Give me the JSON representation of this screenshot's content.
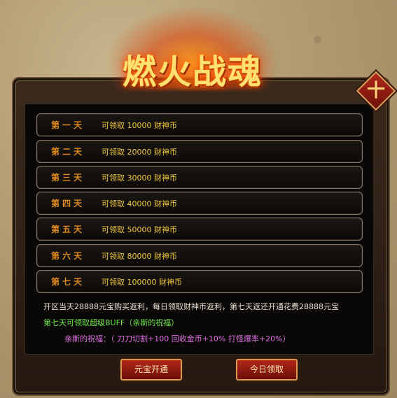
{
  "title": "燃火战魂",
  "close_glyph": "十",
  "rows": [
    {
      "day": "第一天",
      "reward": "可领取 10000 财神币"
    },
    {
      "day": "第二天",
      "reward": "可领取 20000 财神币"
    },
    {
      "day": "第三天",
      "reward": "可领取 30000 财神币"
    },
    {
      "day": "第四天",
      "reward": "可领取 40000 财神币"
    },
    {
      "day": "第五天",
      "reward": "可领取 50000 财神币"
    },
    {
      "day": "第六天",
      "reward": "可领取 80000 财神币"
    },
    {
      "day": "第七天",
      "reward": "可领取 100000 财神币"
    }
  ],
  "note": "开区当天28888元宝购买返利，每日领取财神币返利，第七天返还开通花费28888元宝",
  "buff": "第七天可领取超级BUFF（亲斯的祝福）",
  "blessing": "亲斯的祝福：（ 刀刀切割+100   回收金币+10%  打怪爆率+20%）",
  "buttons": {
    "activate": "元宝开通",
    "claim": "今日领取"
  }
}
